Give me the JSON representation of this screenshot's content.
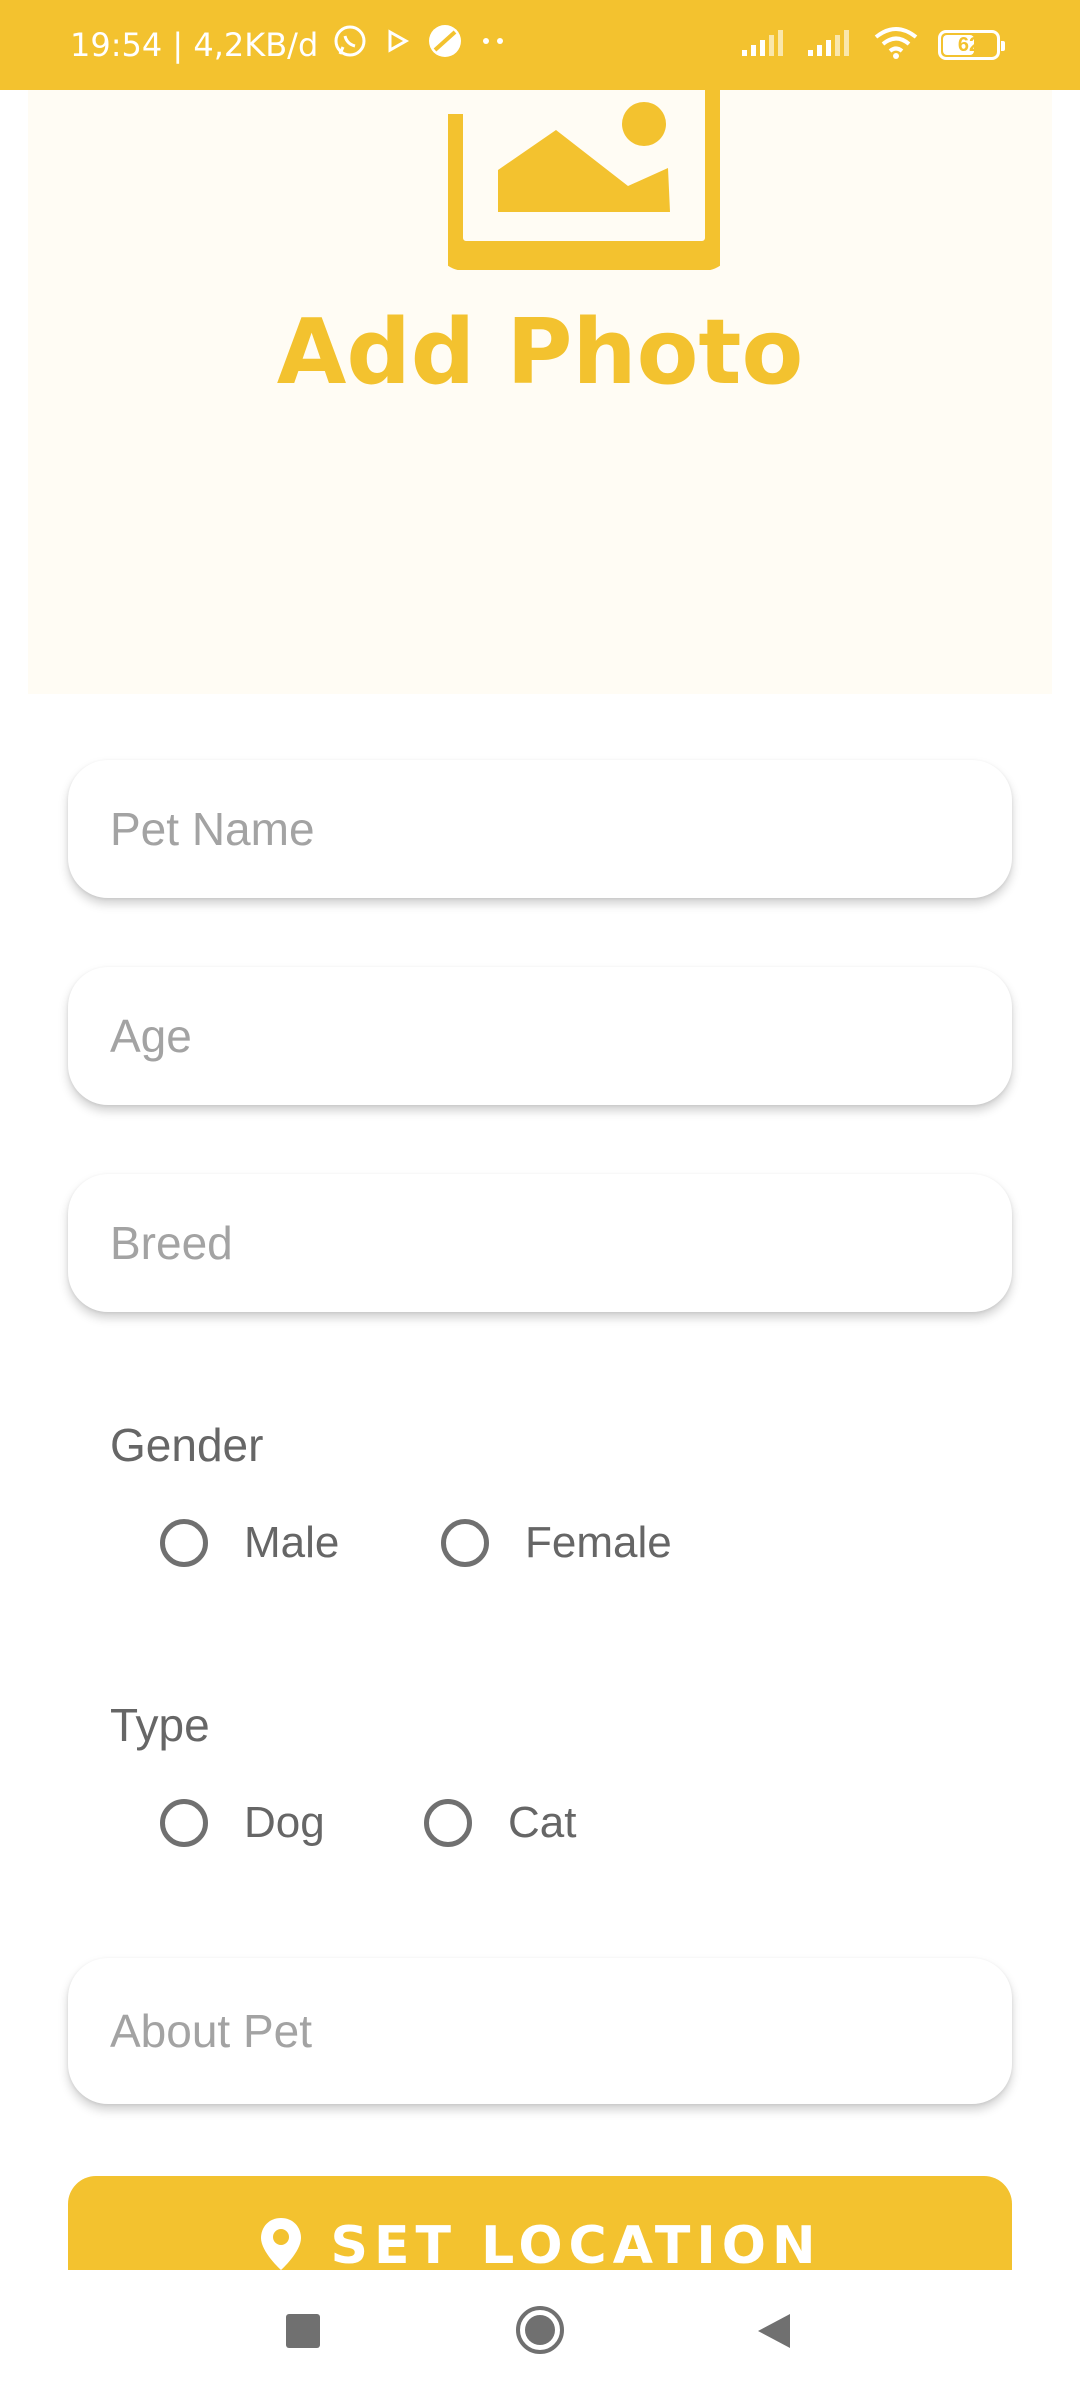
{
  "status_bar": {
    "time_speed": "19:54 | 4,2KB/d",
    "battery": "62",
    "battery_level": 0.62,
    "icons": [
      "whatsapp-icon",
      "play-icon",
      "circle-app-icon",
      "more-dots-icon",
      "signal-icon",
      "signal-icon-2",
      "wifi-icon",
      "battery-icon"
    ]
  },
  "photo": {
    "label": "Add Photo",
    "icon": "image-icon"
  },
  "form": {
    "pet_name_placeholder": "Pet Name",
    "age_placeholder": "Age",
    "breed_placeholder": "Breed",
    "about_placeholder": "About Pet"
  },
  "gender": {
    "label": "Gender",
    "options": [
      "Male",
      "Female"
    ]
  },
  "type": {
    "label": "Type",
    "options": [
      "Dog",
      "Cat"
    ]
  },
  "button": {
    "label": "SET LOCATION",
    "icon": "location-pin-icon"
  },
  "colors": {
    "accent": "#F3C22F",
    "photo_bg": "#FFFCF4",
    "placeholder": "#A3A3A3",
    "label": "#666666"
  },
  "nav_bar": {
    "icons": [
      "recent-apps-icon",
      "home-icon",
      "back-icon"
    ]
  }
}
